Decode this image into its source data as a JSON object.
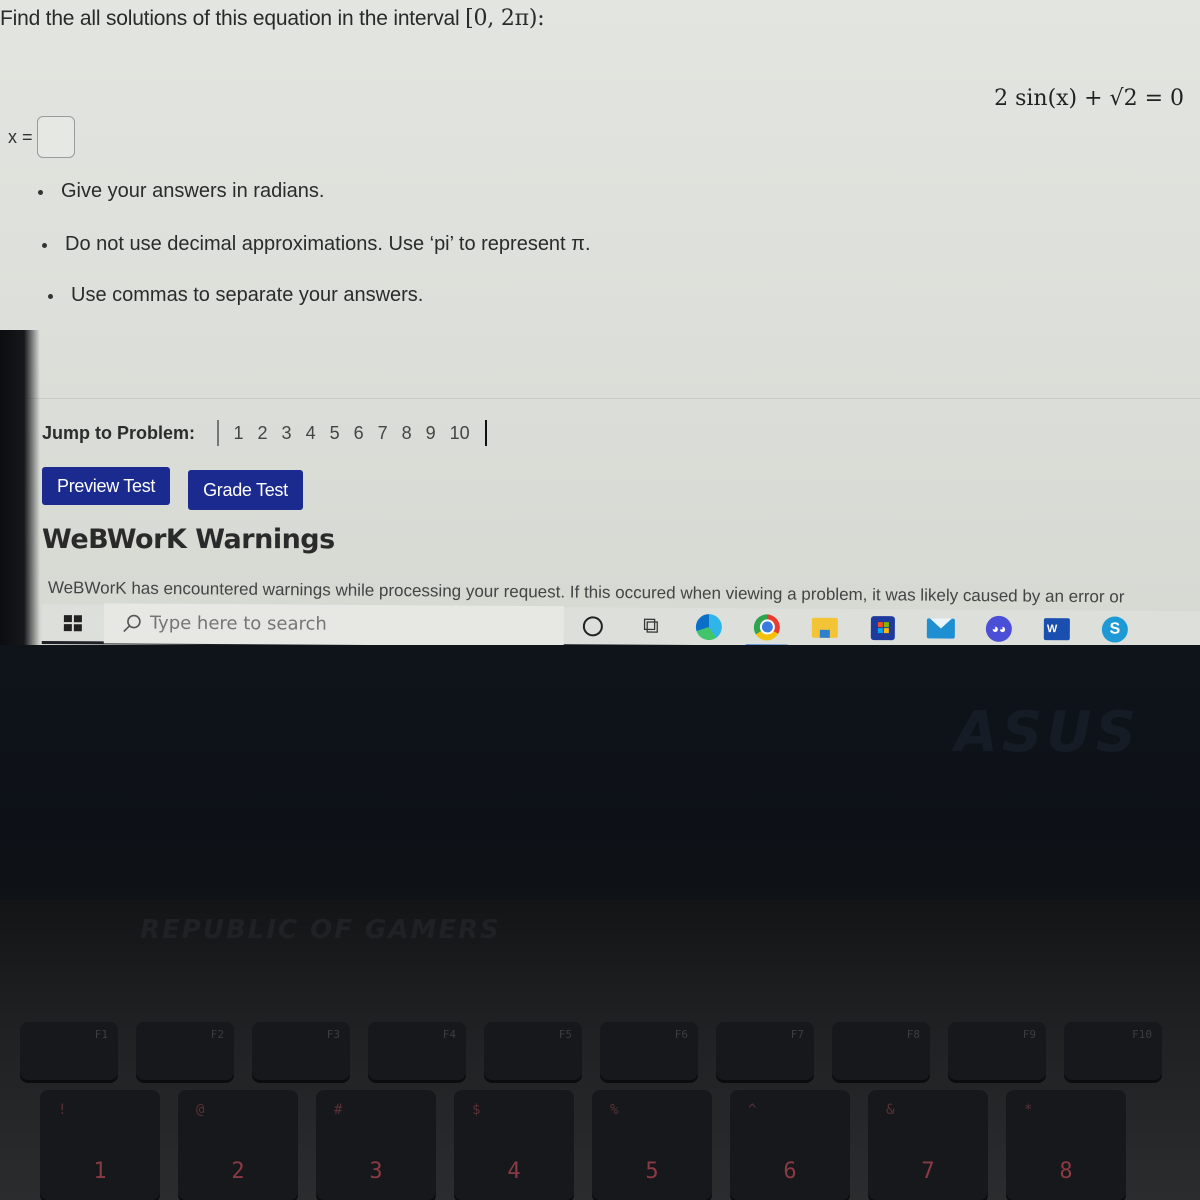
{
  "problem": {
    "prompt": "Find the all solutions of this equation in the interval",
    "interval": "[0, 2π):",
    "equation": "2 sin(x) + √2 = 0",
    "answer_label": "x =",
    "answer_value": "",
    "hints": [
      "Give your answers in radians.",
      "Do not use decimal approximations. Use ‘pi’ to represent π.",
      "Use commas to separate your answers."
    ]
  },
  "navigation": {
    "jump_label": "Jump to Problem:",
    "problems": [
      "1",
      "2",
      "3",
      "4",
      "5",
      "6",
      "7",
      "8",
      "9",
      "10"
    ]
  },
  "buttons": {
    "preview": "Preview Test",
    "grade": "Grade Test"
  },
  "warnings": {
    "title": "WeBWorK Warnings",
    "text": "WeBWorK has encountered warnings while processing your request. If this occured when viewing a problem, it was likely caused by an error or"
  },
  "taskbar": {
    "search_placeholder": "Type here to search",
    "apps": [
      {
        "name": "edge",
        "label": "Microsoft Edge"
      },
      {
        "name": "chrome",
        "label": "Google Chrome",
        "active": true
      },
      {
        "name": "file-explorer",
        "label": "File Explorer"
      },
      {
        "name": "store",
        "label": "Microsoft Store"
      },
      {
        "name": "mail",
        "label": "Mail"
      },
      {
        "name": "discord",
        "label": "Discord"
      },
      {
        "name": "word",
        "label": "Word",
        "glyph": "W"
      },
      {
        "name": "skype",
        "label": "Skype",
        "glyph": "S"
      }
    ]
  },
  "hardware": {
    "brand": "ASUS",
    "tagline": "REPUBLIC OF GAMERS",
    "fn_keys": [
      "F1",
      "F2",
      "F3",
      "F4",
      "F5",
      "F6",
      "F7",
      "F8",
      "F9",
      "F10"
    ],
    "number_keys": [
      {
        "main": "1",
        "shift": "!"
      },
      {
        "main": "2",
        "shift": "@"
      },
      {
        "main": "3",
        "shift": "#"
      },
      {
        "main": "4",
        "shift": "$"
      },
      {
        "main": "5",
        "shift": "%"
      },
      {
        "main": "6",
        "shift": "^"
      },
      {
        "main": "7",
        "shift": "&"
      },
      {
        "main": "8",
        "shift": "*"
      }
    ]
  },
  "colors": {
    "button_bg": "#1b2a8e",
    "page_bg": "#e3e5e0",
    "taskbar_bg": "#dcdfda",
    "active_indicator": "#3b78d8"
  }
}
